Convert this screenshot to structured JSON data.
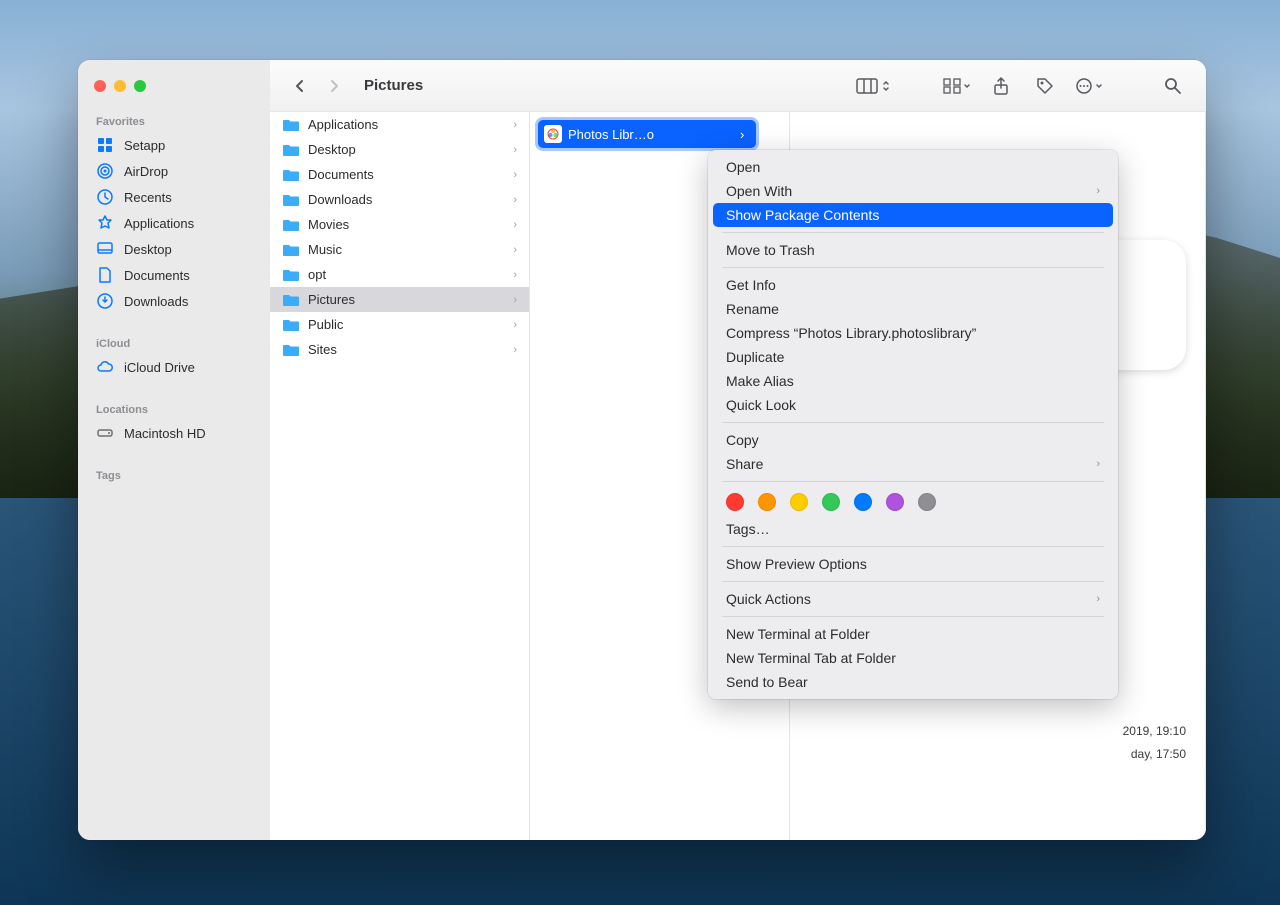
{
  "toolbar": {
    "title": "Pictures"
  },
  "sidebar": {
    "sections": {
      "favorites": {
        "label": "Favorites",
        "items": [
          "Setapp",
          "AirDrop",
          "Recents",
          "Applications",
          "Desktop",
          "Documents",
          "Downloads"
        ]
      },
      "icloud": {
        "label": "iCloud",
        "items": [
          "iCloud Drive"
        ]
      },
      "locations": {
        "label": "Locations",
        "items": [
          "Macintosh HD"
        ]
      },
      "tags": {
        "label": "Tags"
      }
    }
  },
  "column1": {
    "items": [
      "Applications",
      "Desktop",
      "Documents",
      "Downloads",
      "Movies",
      "Music",
      "opt",
      "Pictures",
      "Public",
      "Sites"
    ],
    "selected": "Pictures"
  },
  "column2": {
    "selected_file": "Photos Libr…o"
  },
  "preview": {
    "meta1": "2019, 19:10",
    "meta2": "day, 17:50"
  },
  "context_menu": {
    "items": {
      "open": "Open",
      "open_with": "Open With",
      "show_package": "Show Package Contents",
      "move_trash": "Move to Trash",
      "get_info": "Get Info",
      "rename": "Rename",
      "compress": "Compress “Photos Library.photoslibrary”",
      "duplicate": "Duplicate",
      "make_alias": "Make Alias",
      "quick_look": "Quick Look",
      "copy": "Copy",
      "share": "Share",
      "tags": "Tags…",
      "preview_options": "Show Preview Options",
      "quick_actions": "Quick Actions",
      "new_terminal": "New Terminal at Folder",
      "new_terminal_tab": "New Terminal Tab at Folder",
      "send_to_bear": "Send to Bear"
    }
  }
}
